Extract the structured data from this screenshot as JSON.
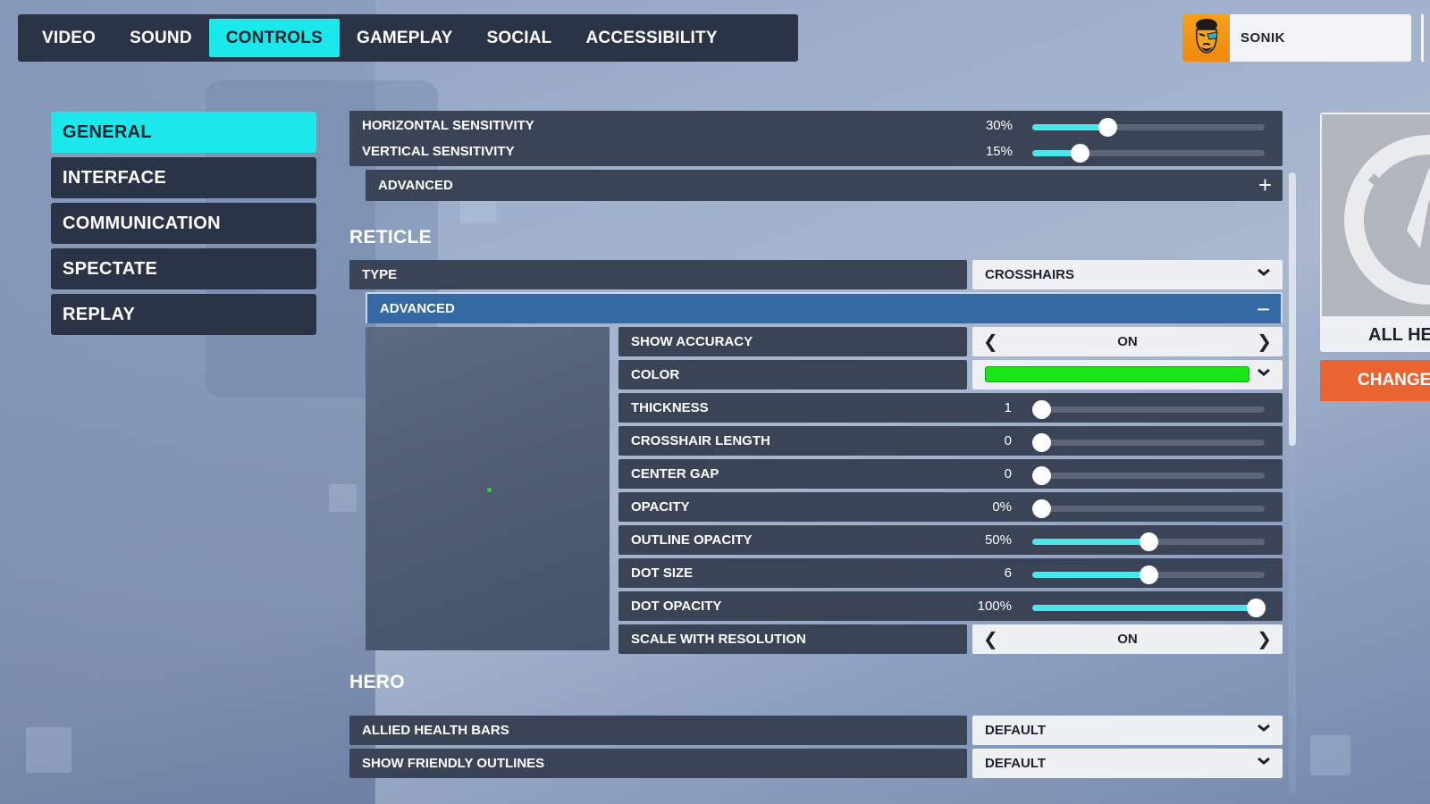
{
  "topnav": {
    "tabs": [
      {
        "label": "VIDEO",
        "active": false
      },
      {
        "label": "SOUND",
        "active": false
      },
      {
        "label": "CONTROLS",
        "active": true
      },
      {
        "label": "GAMEPLAY",
        "active": false
      },
      {
        "label": "SOCIAL",
        "active": false
      },
      {
        "label": "ACCESSIBILITY",
        "active": false
      }
    ]
  },
  "profile": {
    "name": "SONIK",
    "avatar_icon": "player-avatar-icon"
  },
  "sidebar": {
    "items": [
      {
        "label": "GENERAL",
        "active": true
      },
      {
        "label": "INTERFACE",
        "active": false
      },
      {
        "label": "COMMUNICATION",
        "active": false
      },
      {
        "label": "SPECTATE",
        "active": false
      },
      {
        "label": "REPLAY",
        "active": false
      }
    ]
  },
  "aim": {
    "horizontal_sensitivity": {
      "label": "HORIZONTAL SENSITIVITY",
      "value": "30%",
      "fill": 0.31
    },
    "vertical_sensitivity": {
      "label": "VERTICAL SENSITIVITY",
      "value": "15%",
      "fill": 0.18
    },
    "advanced": {
      "label": "ADVANCED",
      "icon": "+",
      "expanded": false
    }
  },
  "reticle": {
    "title": "RETICLE",
    "type": {
      "label": "TYPE",
      "value": "CROSSHAIRS"
    },
    "advanced": {
      "label": "ADVANCED",
      "icon": "−",
      "expanded": true
    },
    "preview_dot_color": "#22e022",
    "settings": {
      "show_accuracy": {
        "label": "SHOW ACCURACY",
        "value": "ON"
      },
      "color": {
        "label": "COLOR",
        "value": "#19e619"
      },
      "thickness": {
        "label": "THICKNESS",
        "value": "1",
        "fill": 0
      },
      "crosshair_length": {
        "label": "CROSSHAIR LENGTH",
        "value": "0",
        "fill": 0
      },
      "center_gap": {
        "label": "CENTER GAP",
        "value": "0",
        "fill": 0
      },
      "opacity": {
        "label": "OPACITY",
        "value": "0%",
        "fill": 0
      },
      "outline_opacity": {
        "label": "OUTLINE OPACITY",
        "value": "50%",
        "fill": 0.5
      },
      "dot_size": {
        "label": "DOT SIZE",
        "value": "6",
        "fill": 0.5
      },
      "dot_opacity": {
        "label": "DOT OPACITY",
        "value": "100%",
        "fill": 1.0
      },
      "scale_with_resolution": {
        "label": "SCALE WITH RESOLUTION",
        "value": "ON"
      }
    }
  },
  "hero": {
    "title": "HERO",
    "allied_health_bars": {
      "label": "ALLIED HEALTH BARS",
      "value": "DEFAULT"
    },
    "show_friendly_outlines": {
      "label": "SHOW FRIENDLY OUTLINES",
      "value": "DEFAULT"
    }
  },
  "hero_card": {
    "label": "ALL HEROES",
    "change_label": "CHANGE HERO"
  },
  "colors": {
    "accent": "#1be8ea",
    "slider_fill": "#4ae7ea",
    "panel": "#3b4457",
    "nav": "#2b3447",
    "advanced_open": "#3469a4",
    "change_button": "#ea6432"
  },
  "scroll": {
    "position": 0.0,
    "visible_fraction": 0.44
  }
}
